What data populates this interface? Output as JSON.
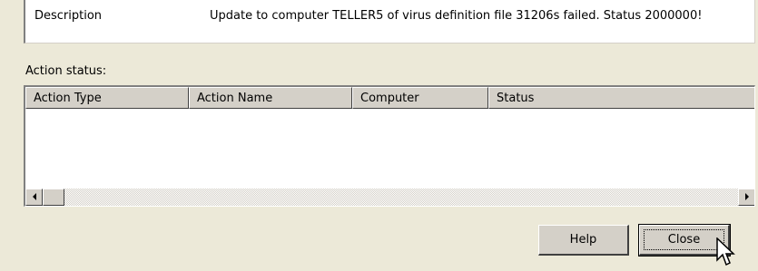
{
  "details": {
    "description_label": "Description",
    "description_value": "Update to computer TELLER5  of virus definition file 31206s failed. Status 2000000!"
  },
  "action_status": {
    "label": "Action status:",
    "columns": [
      "Action Type",
      "Action Name",
      "Computer",
      "Status"
    ],
    "rows": []
  },
  "buttons": {
    "help": "Help",
    "close": "Close"
  }
}
